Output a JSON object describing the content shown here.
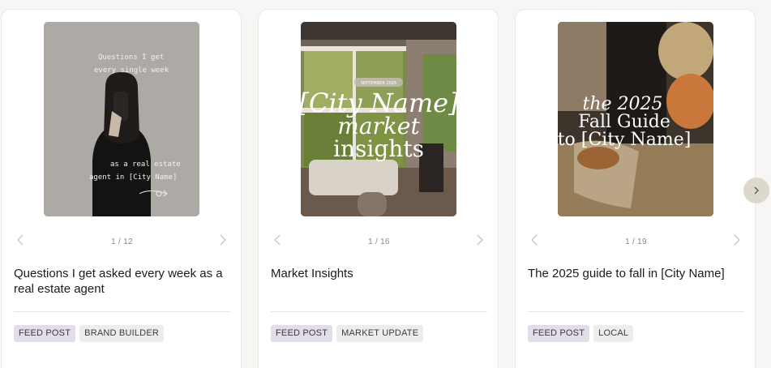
{
  "colors": {
    "page_background": "#f7f6f4",
    "card_background": "#ffffff",
    "primary_tag": "#e3dcea",
    "secondary_tag": "#efedeb",
    "carousel_next_button": "#dcd8cc"
  },
  "icons": {
    "slide_prev": "chevron-left-icon",
    "slide_next": "chevron-right-icon",
    "carousel_next": "chevron-right-icon"
  },
  "cards": [
    {
      "title": "Questions I get asked every week as a real estate agent",
      "counter": "1 / 12",
      "image_text": {
        "top_line1": "Questions I get",
        "top_line2": "every single week",
        "bottom_line1": "as a real estate",
        "bottom_line2": "agent in [City Name]"
      },
      "tags": [
        "FEED POST",
        "BRAND BUILDER"
      ]
    },
    {
      "title": "Market Insights",
      "counter": "1 / 16",
      "image_text": {
        "badge": "SEPTEMBER 2025",
        "line1": "[City Name]",
        "line2": "market",
        "line3": "insights"
      },
      "tags": [
        "FEED POST",
        "MARKET UPDATE"
      ]
    },
    {
      "title": "The 2025 guide to fall in [City Name]",
      "counter": "1 / 19",
      "image_text": {
        "line1": "the 2025",
        "line2": "Fall Guide",
        "line3": "to [City Name]"
      },
      "tags": [
        "FEED POST",
        "LOCAL"
      ]
    }
  ]
}
